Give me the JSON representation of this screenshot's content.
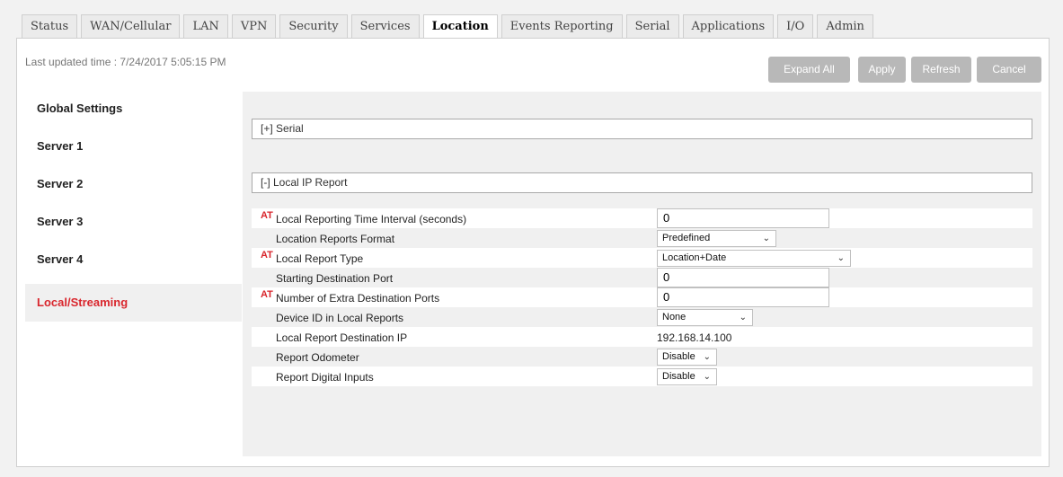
{
  "tabs": [
    "Status",
    "WAN/Cellular",
    "LAN",
    "VPN",
    "Security",
    "Services",
    "Location",
    "Events Reporting",
    "Serial",
    "Applications",
    "I/O",
    "Admin"
  ],
  "active_tab": "Location",
  "last_updated": "Last updated time : 7/24/2017 5:05:15 PM",
  "buttons": {
    "expand_all": "Expand All",
    "apply": "Apply",
    "refresh": "Refresh",
    "cancel": "Cancel"
  },
  "sidebar": [
    "Global Settings",
    "Server 1",
    "Server 2",
    "Server 3",
    "Server 4",
    "Local/Streaming"
  ],
  "sidebar_active": "Local/Streaming",
  "sections": {
    "serial": "[+] Serial",
    "local_ip": "[-] Local IP Report"
  },
  "at_marker": "AT",
  "rows": [
    {
      "label": "Local Reporting Time Interval (seconds)",
      "at": true,
      "type": "text",
      "value": "0"
    },
    {
      "label": "Location Reports Format",
      "at": false,
      "type": "select",
      "value": "Predefined"
    },
    {
      "label": "Local Report Type",
      "at": true,
      "type": "select",
      "value": "Location+Date"
    },
    {
      "label": "Starting Destination Port",
      "at": false,
      "type": "text",
      "value": "0"
    },
    {
      "label": "Number of Extra Destination Ports",
      "at": true,
      "type": "text",
      "value": "0"
    },
    {
      "label": "Device ID in Local Reports",
      "at": false,
      "type": "select",
      "value": "None"
    },
    {
      "label": "Local Report Destination IP",
      "at": false,
      "type": "static",
      "value": "192.168.14.100"
    },
    {
      "label": "Report Odometer",
      "at": false,
      "type": "select",
      "value": "Disable"
    },
    {
      "label": "Report Digital Inputs",
      "at": false,
      "type": "select",
      "value": "Disable"
    }
  ],
  "colors": {
    "accent_red": "#d9262d",
    "button_gray": "#b8b8b8"
  }
}
